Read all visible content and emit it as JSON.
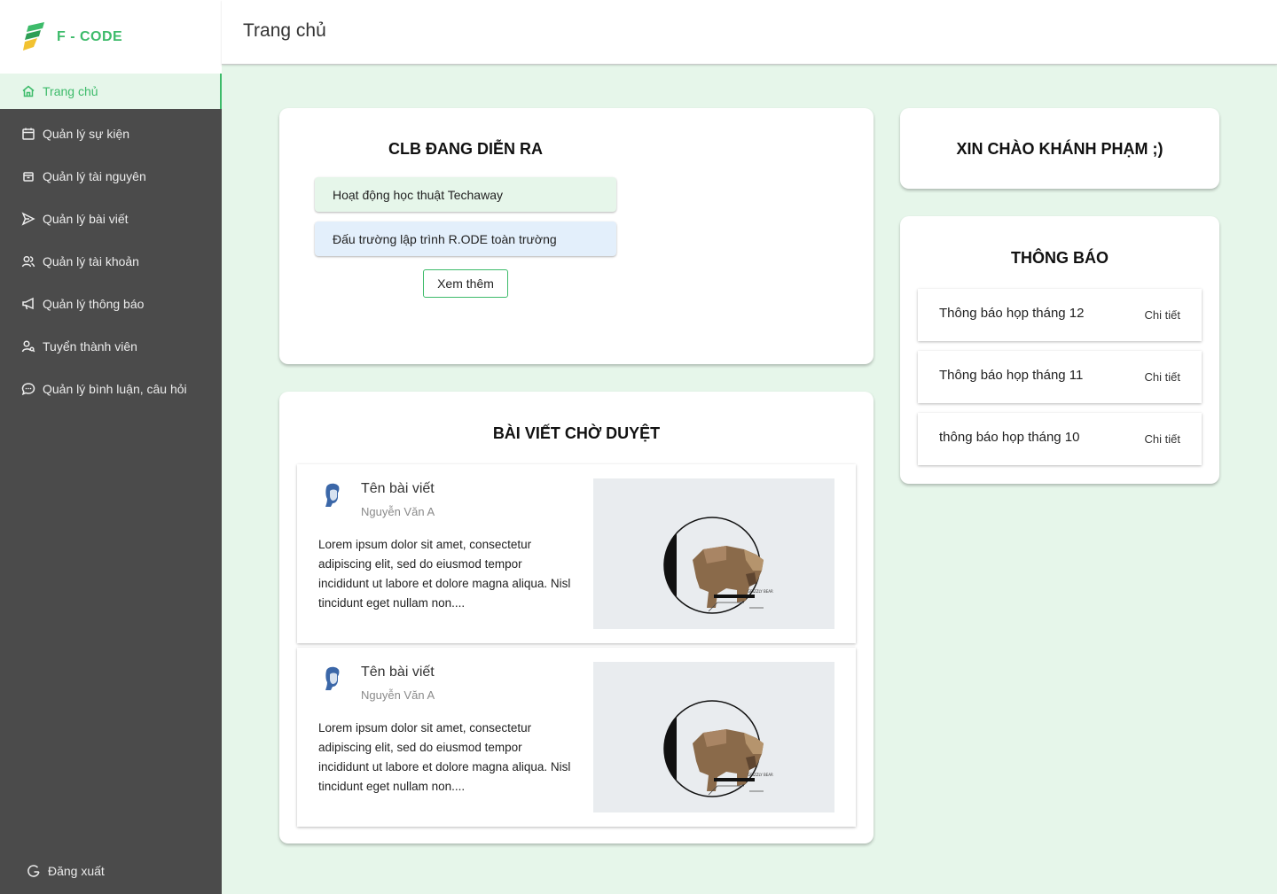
{
  "brand": {
    "name": "F - CODE",
    "accent": "#3dbb6a"
  },
  "sidebar": {
    "items": [
      {
        "label": "Trang chủ",
        "icon": "home-icon",
        "active": true
      },
      {
        "label": "Quản lý sự kiện",
        "icon": "calendar-icon"
      },
      {
        "label": "Quản lý tài nguyên",
        "icon": "box-icon"
      },
      {
        "label": "Quản lý bài viết",
        "icon": "send-icon"
      },
      {
        "label": "Quản lý tài khoản",
        "icon": "users-icon"
      },
      {
        "label": "Quản lý thông báo",
        "icon": "megaphone-icon"
      },
      {
        "label": "Tuyển thành viên",
        "icon": "user-search-icon"
      },
      {
        "label": "Quản lý bình luận, câu hỏi",
        "icon": "chat-icon"
      }
    ],
    "logout_label": "Đăng xuất"
  },
  "header": {
    "title": "Trang chủ"
  },
  "clb": {
    "title": "CLB ĐANG DIỄN RA",
    "items": [
      "Hoạt động học thuật Techaway",
      "Đấu trường lập trình R.ODE toàn trường"
    ],
    "more_label": "Xem thêm"
  },
  "greeting": {
    "text": "XIN CHÀO KHÁNH PHẠM ;)"
  },
  "notifications": {
    "title": "THÔNG BÁO",
    "detail_label": "Chi tiết",
    "items": [
      "Thông báo họp tháng 12",
      "Thông báo họp tháng 11",
      "thông báo họp tháng 10"
    ]
  },
  "posts": {
    "title": "BÀI VIẾT CHỜ DUYỆT",
    "items": [
      {
        "title": "Tên bài viết",
        "author": "Nguyễn Văn A",
        "excerpt": "Lorem ipsum dolor sit amet, consectetur adipiscing elit, sed do eiusmod tempor incididunt ut labore et dolore magna aliqua. Nisl tincidunt eget nullam non....",
        "image_caption": "GRIZZLY BEAR"
      },
      {
        "title": "Tên bài viết",
        "author": "Nguyễn Văn A",
        "excerpt": "Lorem ipsum dolor sit amet, consectetur adipiscing elit, sed do eiusmod tempor incididunt ut labore et dolore magna aliqua. Nisl tincidunt eget nullam non....",
        "image_caption": "GRIZZLY BEAR"
      }
    ]
  }
}
